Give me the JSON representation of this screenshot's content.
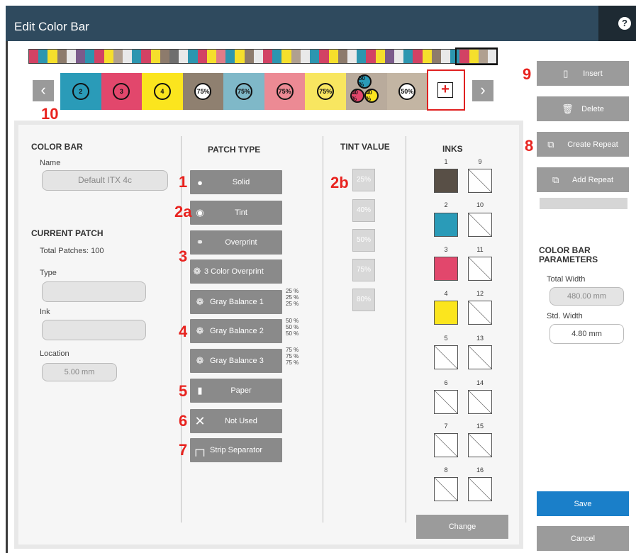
{
  "window": {
    "title": "Edit Color Bar",
    "help": "?"
  },
  "strip": {
    "colors": [
      "#d24264",
      "#2c96b0",
      "#f5df2c",
      "#8d7b6c",
      "#e9e9e9",
      "#7b5b8b",
      "#2c96b0",
      "#d24264",
      "#f5df2c",
      "#b0a090",
      "#e9e9e9",
      "#2c96b0",
      "#d24264",
      "#f5df2c",
      "#8d7b6c",
      "#6e6e6e",
      "#e9e9e9",
      "#2c96b0",
      "#d24264",
      "#f5df2c",
      "#e07c88",
      "#2c96b0",
      "#f5df2c",
      "#8d7b6c",
      "#e9e9e9",
      "#d24264",
      "#2c96b0",
      "#f5df2c",
      "#b0a090",
      "#e9e9e9",
      "#2c96b0",
      "#d24264",
      "#f5df2c",
      "#8d7b6c",
      "#e9e9e9",
      "#2c96b0",
      "#d24264",
      "#f5df2c",
      "#7b5b8b",
      "#e9e9e9",
      "#2c96b0",
      "#d24264",
      "#f5df2c",
      "#8d7b6c",
      "#e9e9e9",
      "#2c96b0",
      "#d24264",
      "#f5df2c",
      "#b0a090",
      "#e9e9e9"
    ]
  },
  "patches": [
    {
      "label": "2",
      "bg": "#2a9bb8"
    },
    {
      "label": "3",
      "bg": "#e2476c"
    },
    {
      "label": "4",
      "bg": "#fbe51e"
    },
    {
      "label": "75%",
      "bg": "#8f8070"
    },
    {
      "label": "75%",
      "bg": "#7fb8c8"
    },
    {
      "label": "75%",
      "bg": "#ec8a94"
    },
    {
      "label": "75%",
      "bg": "#f8e660"
    },
    {
      "label": "",
      "bg": "#b9ab9c"
    },
    {
      "label": "50%",
      "bg": "#c3b5a3"
    }
  ],
  "overprint_circles": {
    "a": "50 %",
    "b": "40 %",
    "c": "40 %"
  },
  "callouts": {
    "c10": "10",
    "c9": "9",
    "c8": "8",
    "c1": "1",
    "c2a": "2a",
    "c2b": "2b",
    "c3": "3",
    "c4": "4",
    "c5": "5",
    "c6": "6",
    "c7": "7"
  },
  "color_bar": {
    "heading": "COLOR BAR",
    "name_label": "Name",
    "name_value": "Default ITX 4c"
  },
  "current_patch": {
    "heading": "CURRENT PATCH",
    "total": "Total Patches: 100",
    "type_label": "Type",
    "ink_label": "Ink",
    "location_label": "Location",
    "location_value": "5.00 mm"
  },
  "patch_type": {
    "heading": "PATCH TYPE",
    "buttons": [
      "Solid",
      "Tint",
      "Overprint",
      "3 Color Overprint",
      "Gray Balance 1",
      "Gray Balance 2",
      "Gray Balance 3",
      "Paper",
      "Not Used",
      "Strip Separator"
    ],
    "gb1": [
      "25 %",
      "25 %",
      "25 %"
    ],
    "gb2": [
      "50 %",
      "50 %",
      "50 %"
    ],
    "gb3": [
      "75 %",
      "75 %",
      "75 %"
    ]
  },
  "tint_value": {
    "heading": "TINT VALUE",
    "values": [
      "25%",
      "40%",
      "50%",
      "75%",
      "80%"
    ]
  },
  "inks": {
    "heading": "INKS",
    "numbers": [
      "1",
      "9",
      "2",
      "10",
      "3",
      "11",
      "4",
      "12",
      "5",
      "13",
      "6",
      "14",
      "7",
      "15",
      "8",
      "16"
    ],
    "colors": {
      "1": "#584f46",
      "2": "#2a9bb8",
      "3": "#e2476c",
      "4": "#fbe51e"
    },
    "change": "Change"
  },
  "side": {
    "insert": "Insert",
    "delete": "Delete",
    "create_repeat": "Create Repeat",
    "add_repeat": "Add Repeat",
    "save": "Save",
    "cancel": "Cancel"
  },
  "params": {
    "heading": "COLOR BAR PARAMETERS",
    "total_width_label": "Total Width",
    "total_width_value": "480.00 mm",
    "std_width_label": "Std. Width",
    "std_width_value": "4.80 mm"
  }
}
